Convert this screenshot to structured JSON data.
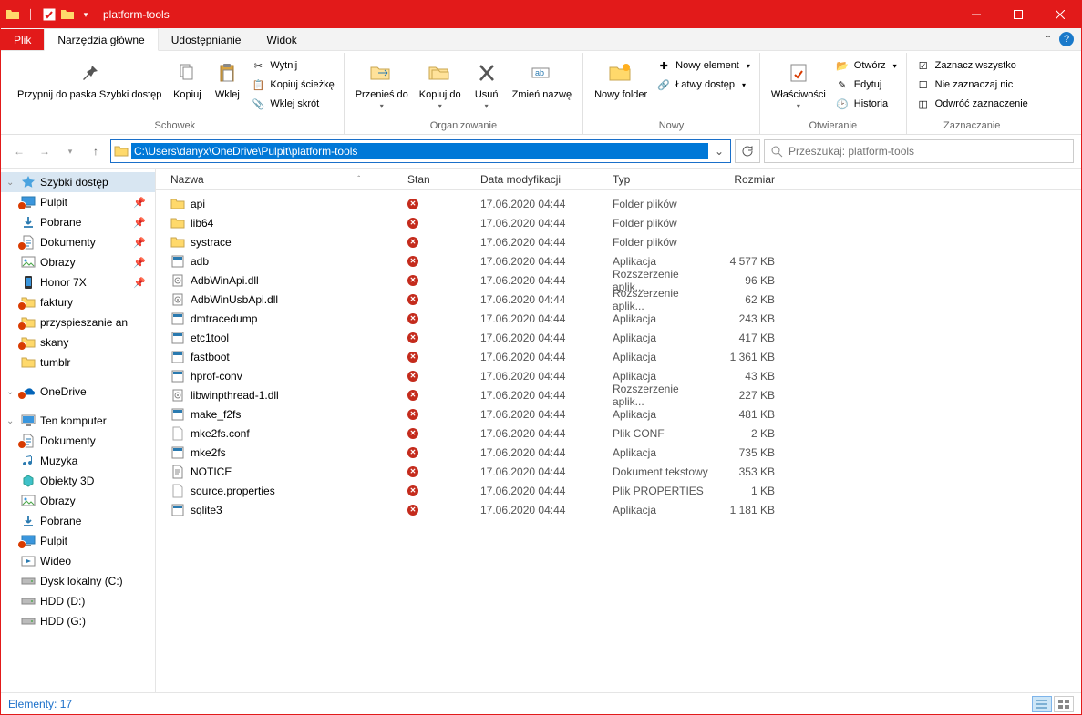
{
  "window": {
    "title": "platform-tools"
  },
  "tabs": {
    "file": "Plik",
    "home": "Narzędzia główne",
    "share": "Udostępnianie",
    "view": "Widok"
  },
  "ribbon": {
    "clipboard": {
      "label": "Schowek",
      "pin": "Przypnij do paska\nSzybki dostęp",
      "copy": "Kopiuj",
      "paste": "Wklej",
      "cut": "Wytnij",
      "copy_path": "Kopiuj ścieżkę",
      "paste_shortcut": "Wklej skrót"
    },
    "organize": {
      "label": "Organizowanie",
      "move_to": "Przenieś\ndo",
      "copy_to": "Kopiuj\ndo",
      "delete": "Usuń",
      "rename": "Zmień\nnazwę"
    },
    "new": {
      "label": "Nowy",
      "new_folder": "Nowy\nfolder",
      "new_item": "Nowy element",
      "easy_access": "Łatwy dostęp"
    },
    "open": {
      "label": "Otwieranie",
      "properties": "Właściwości",
      "open": "Otwórz",
      "edit": "Edytuj",
      "history": "Historia"
    },
    "select": {
      "label": "Zaznaczanie",
      "select_all": "Zaznacz wszystko",
      "select_none": "Nie zaznaczaj nic",
      "invert": "Odwróć zaznaczenie"
    }
  },
  "address": {
    "path": "C:\\Users\\danyx\\OneDrive\\Pulpit\\platform-tools"
  },
  "search": {
    "placeholder": "Przeszukaj: platform-tools"
  },
  "nav_pane": [
    {
      "icon": "star",
      "label": "Szybki dostęp",
      "selected": true,
      "exp": true
    },
    {
      "icon": "desktop",
      "label": "Pulpit",
      "pin": true,
      "sync": true
    },
    {
      "icon": "download",
      "label": "Pobrane",
      "pin": true
    },
    {
      "icon": "document",
      "label": "Dokumenty",
      "pin": true,
      "sync": true
    },
    {
      "icon": "pictures",
      "label": "Obrazy",
      "pin": true
    },
    {
      "icon": "phone",
      "label": "Honor 7X",
      "pin": true
    },
    {
      "icon": "folder",
      "label": "faktury",
      "sync": true
    },
    {
      "icon": "folder",
      "label": "przyspieszanie an",
      "sync": true
    },
    {
      "icon": "folder",
      "label": "skany",
      "sync": true
    },
    {
      "icon": "folder",
      "label": "tumblr"
    },
    {
      "sep": true
    },
    {
      "icon": "onedrive",
      "label": "OneDrive",
      "exp": true,
      "sync": true
    },
    {
      "sep": true
    },
    {
      "icon": "thispc",
      "label": "Ten komputer",
      "exp": true
    },
    {
      "icon": "document",
      "label": "Dokumenty",
      "sync": true
    },
    {
      "icon": "music",
      "label": "Muzyka"
    },
    {
      "icon": "objects3d",
      "label": "Obiekty 3D"
    },
    {
      "icon": "pictures",
      "label": "Obrazy"
    },
    {
      "icon": "download",
      "label": "Pobrane"
    },
    {
      "icon": "desktop",
      "label": "Pulpit",
      "sync": true
    },
    {
      "icon": "video",
      "label": "Wideo"
    },
    {
      "icon": "drive",
      "label": "Dysk lokalny (C:)"
    },
    {
      "icon": "drive",
      "label": "HDD (D:)"
    },
    {
      "icon": "drive",
      "label": "HDD (G:)"
    }
  ],
  "columns": {
    "name": "Nazwa",
    "status": "Stan",
    "date": "Data modyfikacji",
    "type": "Typ",
    "size": "Rozmiar"
  },
  "files": [
    {
      "icon": "folder",
      "name": "api",
      "status": "err",
      "date": "17.06.2020 04:44",
      "type": "Folder plików",
      "size": ""
    },
    {
      "icon": "folder",
      "name": "lib64",
      "status": "err",
      "date": "17.06.2020 04:44",
      "type": "Folder plików",
      "size": ""
    },
    {
      "icon": "folder",
      "name": "systrace",
      "status": "err",
      "date": "17.06.2020 04:44",
      "type": "Folder plików",
      "size": ""
    },
    {
      "icon": "exe",
      "name": "adb",
      "status": "err",
      "date": "17.06.2020 04:44",
      "type": "Aplikacja",
      "size": "4 577 KB"
    },
    {
      "icon": "dll",
      "name": "AdbWinApi.dll",
      "status": "err",
      "date": "17.06.2020 04:44",
      "type": "Rozszerzenie aplik...",
      "size": "96 KB"
    },
    {
      "icon": "dll",
      "name": "AdbWinUsbApi.dll",
      "status": "err",
      "date": "17.06.2020 04:44",
      "type": "Rozszerzenie aplik...",
      "size": "62 KB"
    },
    {
      "icon": "exe",
      "name": "dmtracedump",
      "status": "err",
      "date": "17.06.2020 04:44",
      "type": "Aplikacja",
      "size": "243 KB"
    },
    {
      "icon": "exe",
      "name": "etc1tool",
      "status": "err",
      "date": "17.06.2020 04:44",
      "type": "Aplikacja",
      "size": "417 KB"
    },
    {
      "icon": "exe",
      "name": "fastboot",
      "status": "err",
      "date": "17.06.2020 04:44",
      "type": "Aplikacja",
      "size": "1 361 KB"
    },
    {
      "icon": "exe",
      "name": "hprof-conv",
      "status": "err",
      "date": "17.06.2020 04:44",
      "type": "Aplikacja",
      "size": "43 KB"
    },
    {
      "icon": "dll",
      "name": "libwinpthread-1.dll",
      "status": "err",
      "date": "17.06.2020 04:44",
      "type": "Rozszerzenie aplik...",
      "size": "227 KB"
    },
    {
      "icon": "exe",
      "name": "make_f2fs",
      "status": "err",
      "date": "17.06.2020 04:44",
      "type": "Aplikacja",
      "size": "481 KB"
    },
    {
      "icon": "file",
      "name": "mke2fs.conf",
      "status": "err",
      "date": "17.06.2020 04:44",
      "type": "Plik CONF",
      "size": "2 KB"
    },
    {
      "icon": "exe",
      "name": "mke2fs",
      "status": "err",
      "date": "17.06.2020 04:44",
      "type": "Aplikacja",
      "size": "735 KB"
    },
    {
      "icon": "txt",
      "name": "NOTICE",
      "status": "err",
      "date": "17.06.2020 04:44",
      "type": "Dokument tekstowy",
      "size": "353 KB"
    },
    {
      "icon": "file",
      "name": "source.properties",
      "status": "err",
      "date": "17.06.2020 04:44",
      "type": "Plik PROPERTIES",
      "size": "1 KB"
    },
    {
      "icon": "exe",
      "name": "sqlite3",
      "status": "err",
      "date": "17.06.2020 04:44",
      "type": "Aplikacja",
      "size": "1 181 KB"
    }
  ],
  "statusbar": {
    "items": "Elementy: 17"
  }
}
